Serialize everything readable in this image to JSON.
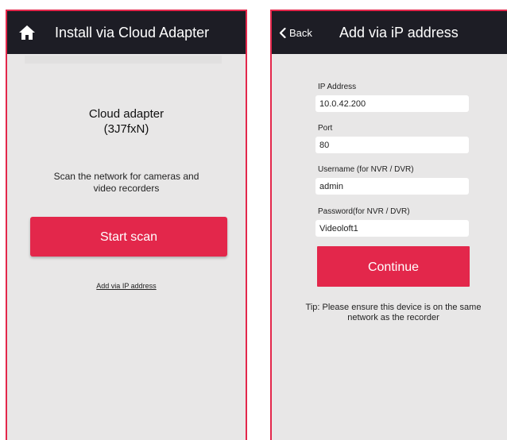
{
  "left_screen": {
    "header_title": "Install via Cloud Adapter",
    "adapter_name": "Cloud adapter",
    "adapter_id": "(3J7fxN)",
    "scan_description_line1": "Scan the network for cameras and",
    "scan_description_line2": "video recorders",
    "start_scan_label": "Start scan",
    "add_via_ip_link": "Add via IP address"
  },
  "right_screen": {
    "back_label": "Back",
    "header_title": "Add via iP address",
    "fields": [
      {
        "label": "IP Address",
        "value": "10.0.42.200"
      },
      {
        "label": "Port",
        "value": "80"
      },
      {
        "label": "Username (for NVR / DVR)",
        "value": "admin"
      },
      {
        "label": "Password(for NVR / DVR)",
        "value": "Videoloft1"
      }
    ],
    "continue_label": "Continue",
    "tip_line1": "Tip: Please ensure this device is on the same",
    "tip_line2": "network as the recorder"
  },
  "colors": {
    "accent": "#e3274b",
    "header_bg": "#1d1d25",
    "screen_bg": "#e8e7e7"
  },
  "icons": [
    "home-icon",
    "chevron-left-icon"
  ]
}
